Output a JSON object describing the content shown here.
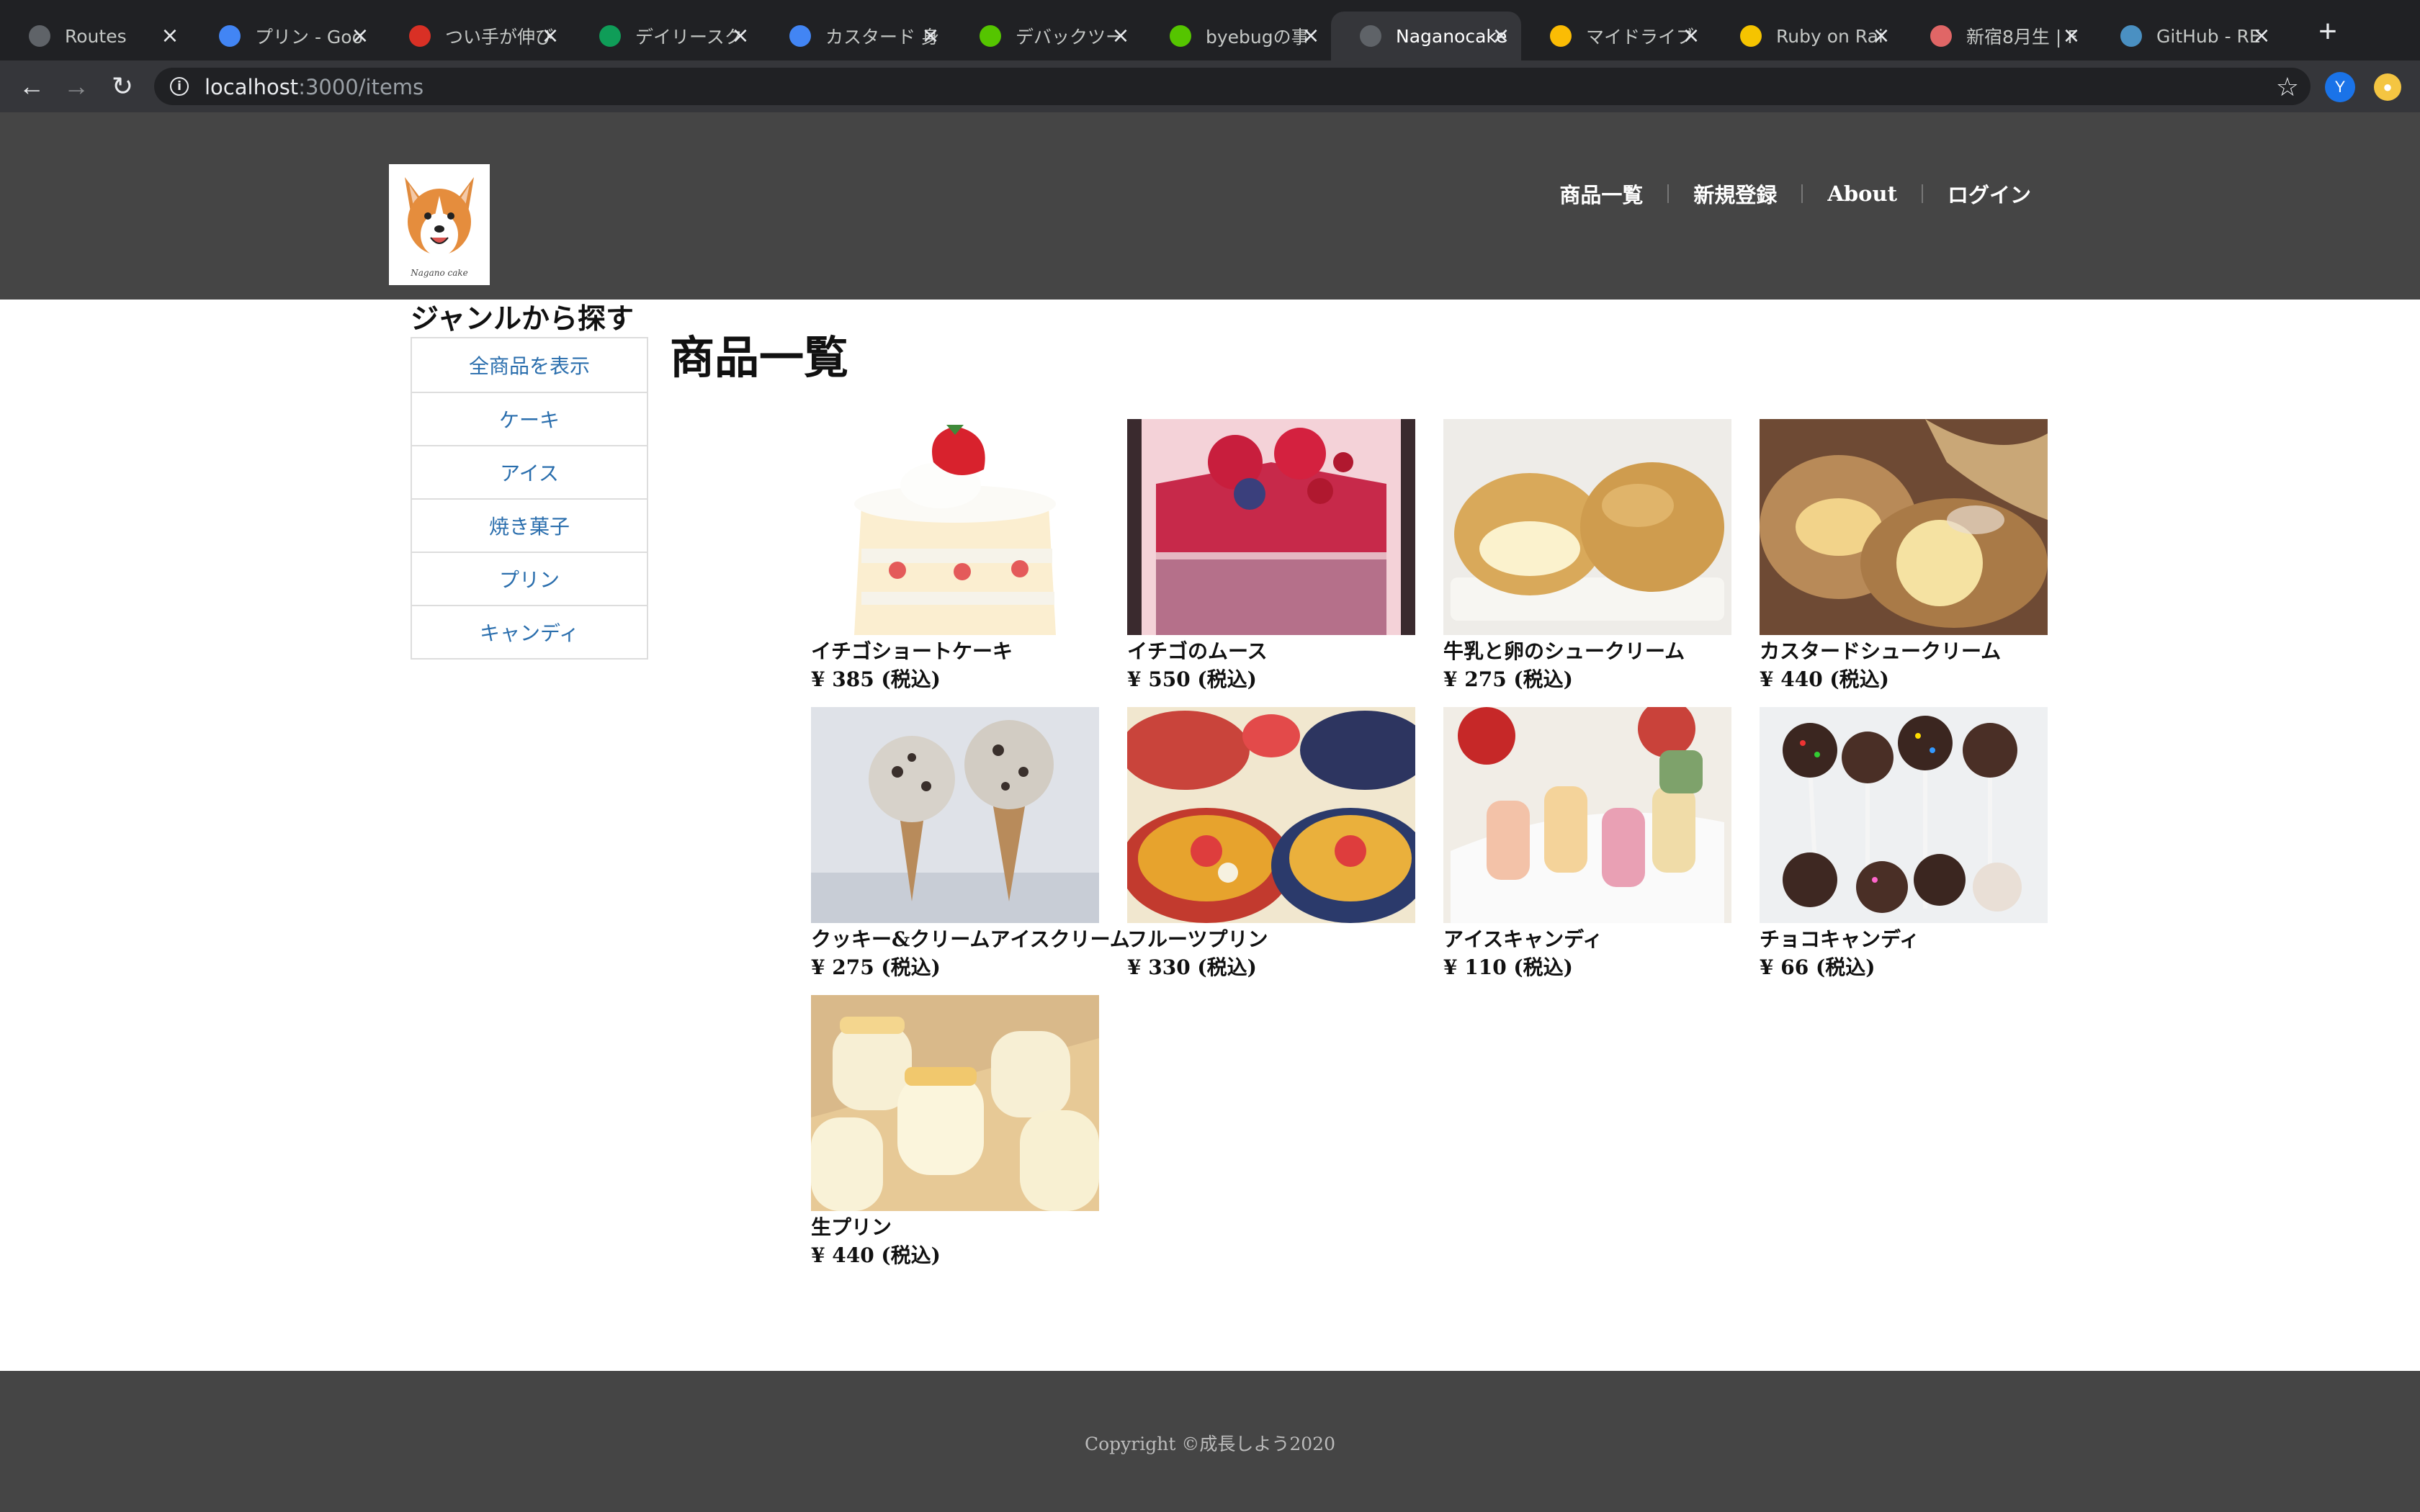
{
  "browser": {
    "tabs": [
      {
        "title": "Routes",
        "icon": "globe-icon",
        "color": "#5f6368"
      },
      {
        "title": "プリン - Goo",
        "icon": "google-icon",
        "color": "#4285f4"
      },
      {
        "title": "つい手が伸び",
        "icon": "d-app-icon",
        "color": "#d93025"
      },
      {
        "title": "デイリースク",
        "icon": "sheets-icon",
        "color": "#0f9d58"
      },
      {
        "title": "カスタード 身",
        "icon": "google-icon",
        "color": "#4285f4"
      },
      {
        "title": "デバックツー",
        "icon": "qiita-icon",
        "color": "#55c500"
      },
      {
        "title": "byebugの事",
        "icon": "qiita-icon",
        "color": "#55c500"
      },
      {
        "title": "Naganocake",
        "icon": "globe-icon",
        "color": "#5f6368"
      },
      {
        "title": "マイドライブ",
        "icon": "drive-icon",
        "color": "#fbbc04"
      },
      {
        "title": "Ruby on Rai",
        "icon": "railsguides-icon",
        "color": "#f5c400"
      },
      {
        "title": "新宿8月生 | F",
        "icon": "school-icon",
        "color": "#e06666"
      },
      {
        "title": "GitHub - RE",
        "icon": "github-icon",
        "color": "#4a90c2"
      }
    ],
    "active_tab": 7,
    "url_host": "localhost",
    "url_path": ":3000/items",
    "profile_initial": "Y"
  },
  "header": {
    "logo_text": "Nagano cake",
    "nav": [
      "商品一覧",
      "新規登録",
      "About",
      "ログイン"
    ]
  },
  "sidebar": {
    "title": "ジャンルから探す",
    "genres": [
      "全商品を表示",
      "ケーキ",
      "アイス",
      "焼き菓子",
      "プリン",
      "キャンディ"
    ]
  },
  "main": {
    "title": "商品一覧",
    "items": [
      {
        "name": "イチゴショートケーキ",
        "price": "¥ 385 (税込)",
        "image": "strawberry-shortcake-photo"
      },
      {
        "name": "イチゴのムース",
        "price": "¥ 550 (税込)",
        "image": "strawberry-mousse-photo"
      },
      {
        "name": "牛乳と卵のシュークリーム",
        "price": "¥ 275 (税込)",
        "image": "cream-puff-photo"
      },
      {
        "name": "カスタードシュークリーム",
        "price": "¥ 440 (税込)",
        "image": "custard-puff-photo"
      },
      {
        "name": "クッキー&クリームアイスクリーム",
        "price": "¥ 275 (税込)",
        "image": "cookies-cream-ice-cream-photo"
      },
      {
        "name": "フルーツプリン",
        "price": "¥ 330 (税込)",
        "image": "fruit-pudding-photo"
      },
      {
        "name": "アイスキャンディ",
        "price": "¥ 110 (税込)",
        "image": "ice-candy-photo"
      },
      {
        "name": "チョコキャンディ",
        "price": "¥ 66 (税込)",
        "image": "choco-candy-photo"
      },
      {
        "name": "生プリン",
        "price": "¥ 440 (税込)",
        "image": "fresh-pudding-photo"
      }
    ]
  },
  "footer": {
    "copyright": "Copyright ©成長しよう2020"
  }
}
